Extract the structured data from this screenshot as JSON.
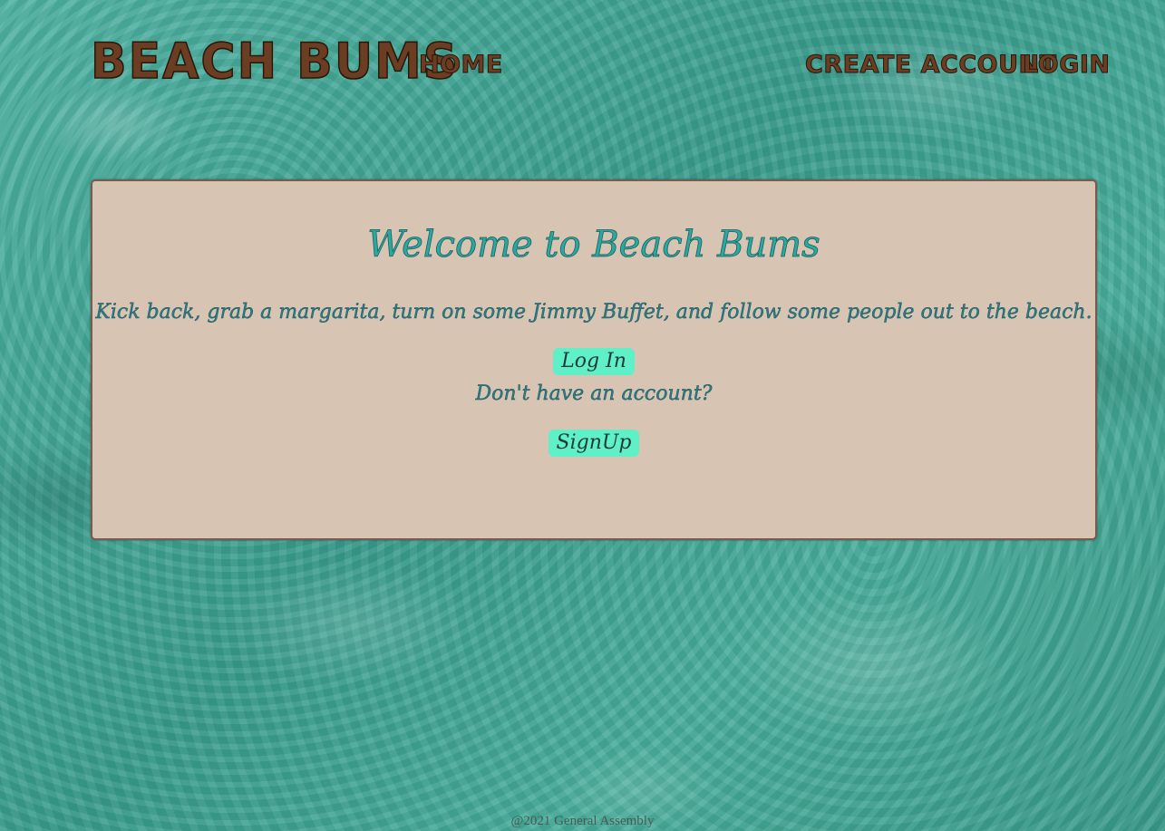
{
  "header": {
    "brand": "BEACH BUMS",
    "nav_left": [
      {
        "label": "HOME"
      }
    ],
    "nav_right": [
      {
        "label": "CREATE ACCOUNT"
      },
      {
        "label": "LOGIN"
      }
    ]
  },
  "main": {
    "title": "Welcome to Beach Bums",
    "tagline": "Kick back, grab a margarita, turn on some Jimmy Buffet, and follow some people out to the beach.",
    "login_button": "Log In",
    "no_account_text": "Don't have an account?",
    "signup_button": "SignUp"
  },
  "footer": {
    "copyright": "@2021 General Assembly"
  },
  "colors": {
    "ocean": "#3fa595",
    "card_background": "#d8c4b2",
    "card_border": "#7a5a4e",
    "brand_brown": "#6b3d22",
    "title_teal": "#2aa8a2",
    "button_mint": "#5ff0c8"
  }
}
